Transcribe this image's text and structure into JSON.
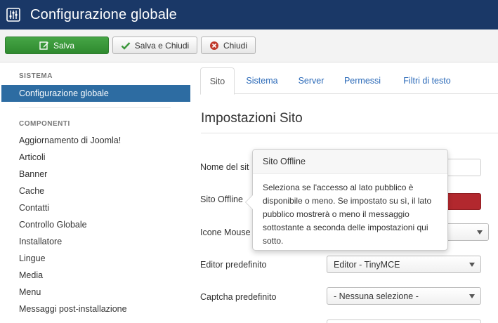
{
  "header": {
    "title": "Configurazione globale",
    "icon": "sliders-icon"
  },
  "toolbar": {
    "save_label": "Salva",
    "save_close_label": "Salva e Chiudi",
    "close_label": "Chiudi",
    "save_color": "#3b963b",
    "close_icon_color": "#c0392b"
  },
  "sidebar": {
    "system_heading": "SISTEMA",
    "active_item": "Configurazione globale",
    "components_heading": "COMPONENTI",
    "items": [
      "Aggiornamento di Joomla!",
      "Articoli",
      "Banner",
      "Cache",
      "Contatti",
      "Controllo Globale",
      "Installatore",
      "Lingue",
      "Media",
      "Menu",
      "Messaggi post-installazione"
    ]
  },
  "tabs": [
    {
      "label": "Sito",
      "active": true
    },
    {
      "label": "Sistema",
      "active": false
    },
    {
      "label": "Server",
      "active": false
    },
    {
      "label": "Permessi",
      "active": false
    },
    {
      "label": "Filtri di testo",
      "active": false
    }
  ],
  "main": {
    "section_title": "Impostazioni Sito",
    "fields": {
      "site_name_label": "Nome del sit",
      "site_offline_label": "Sito Offline",
      "mouse_icons_label": "Icone Mouse",
      "default_editor_label": "Editor predefinito",
      "default_editor_value": "Editor - TinyMCE",
      "default_captcha_label": "Captcha predefinito",
      "default_captcha_value": "- Nessuna selezione -"
    }
  },
  "popover": {
    "title": "Sito Offline",
    "body": "Seleziona se l'accesso al lato pubblico è disponibile o meno. Se impostato su sì, il lato pubblico mostrerà o meno il messaggio sottostante a seconda delle impostazioni qui sotto."
  }
}
